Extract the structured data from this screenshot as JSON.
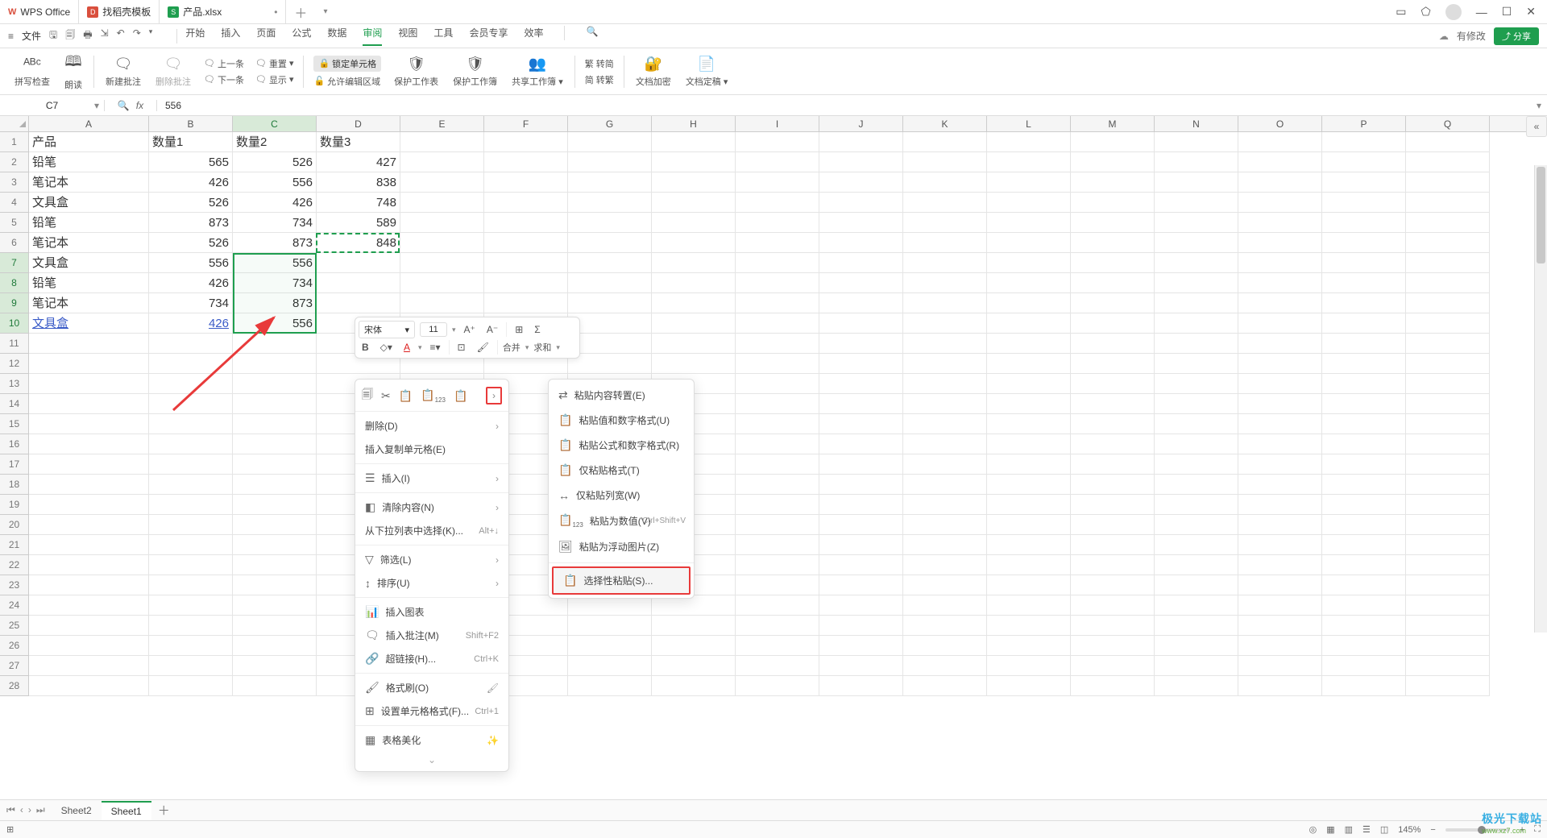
{
  "title_tabs": [
    {
      "icon": "wps",
      "label": "WPS Office"
    },
    {
      "icon": "doc",
      "label": "找稻壳模板"
    },
    {
      "icon": "xls",
      "label": "产品.xlsx",
      "modified": true
    }
  ],
  "menu": {
    "file": "文件",
    "tabs": [
      "开始",
      "插入",
      "页面",
      "公式",
      "数据",
      "审阅",
      "视图",
      "工具",
      "会员专享",
      "效率"
    ],
    "active": "审阅",
    "pending_label": "有修改",
    "share": "分享"
  },
  "ribbon": {
    "spellcheck": "拼写检查",
    "read": "朗读",
    "new_comment": "新建批注",
    "del_comment": "删除批注",
    "prev": "上一条",
    "next": "下一条",
    "reset": "重置",
    "show": "显示",
    "lock_cell": "锁定单元格",
    "allow_edit": "允许编辑区域",
    "protect_sheet": "保护工作表",
    "protect_book": "保护工作簿",
    "share_book": "共享工作簿",
    "simp": "繁 转简",
    "trad": "简 转繁",
    "encrypt": "文档加密",
    "final": "文档定稿"
  },
  "name_box": "C7",
  "formula": "556",
  "columns": [
    "A",
    "B",
    "C",
    "D",
    "E",
    "F",
    "G",
    "H",
    "I",
    "J",
    "K",
    "L",
    "M",
    "N",
    "O",
    "P",
    "Q"
  ],
  "rows_count": 28,
  "data": {
    "headers": [
      "产品",
      "数量1",
      "数量2",
      "数量3"
    ],
    "rows": [
      [
        "铅笔",
        "565",
        "526",
        "427"
      ],
      [
        "笔记本",
        "426",
        "556",
        "838"
      ],
      [
        "文具盒",
        "526",
        "426",
        "748"
      ],
      [
        "铅笔",
        "873",
        "734",
        "589"
      ],
      [
        "笔记本",
        "526",
        "873",
        "848"
      ],
      [
        "文具盒",
        "556",
        "556",
        ""
      ],
      [
        "铅笔",
        "426",
        "734",
        ""
      ],
      [
        "笔记本",
        "734",
        "873",
        ""
      ],
      [
        "文具盒",
        "426",
        "556",
        ""
      ]
    ]
  },
  "mini_toolbar": {
    "font": "宋体",
    "size": "11",
    "merge": "合并",
    "sum": "求和"
  },
  "context": {
    "delete": "删除(D)",
    "insert_copied": "插入复制单元格(E)",
    "insert": "插入(I)",
    "clear": "清除内容(N)",
    "from_dropdown": "从下拉列表中选择(K)...",
    "from_dropdown_key": "Alt+↓",
    "filter": "筛选(L)",
    "sort": "排序(U)",
    "chart": "插入图表",
    "comment": "插入批注(M)",
    "comment_key": "Shift+F2",
    "hyperlink": "超链接(H)...",
    "hyperlink_key": "Ctrl+K",
    "format_painter": "格式刷(O)",
    "format_cells": "设置单元格格式(F)...",
    "format_cells_key": "Ctrl+1",
    "beautify": "表格美化"
  },
  "submenu": {
    "transpose": "粘贴内容转置(E)",
    "values_fmt": "粘贴值和数字格式(U)",
    "formulas_fmt": "粘贴公式和数字格式(R)",
    "only_fmt": "仅粘贴格式(T)",
    "only_colw": "仅粘贴列宽(W)",
    "as_value": "粘贴为数值(V)",
    "as_value_key": "Ctrl+Shift+V",
    "as_float_pic": "粘贴为浮动图片(Z)",
    "paste_special": "选择性粘贴(S)..."
  },
  "sheets": {
    "items": [
      "Sheet2",
      "Sheet1"
    ],
    "active": "Sheet1"
  },
  "status": {
    "zoom": "145%"
  },
  "watermark": {
    "big": "极光下载站",
    "small": "www.xz7.com"
  }
}
